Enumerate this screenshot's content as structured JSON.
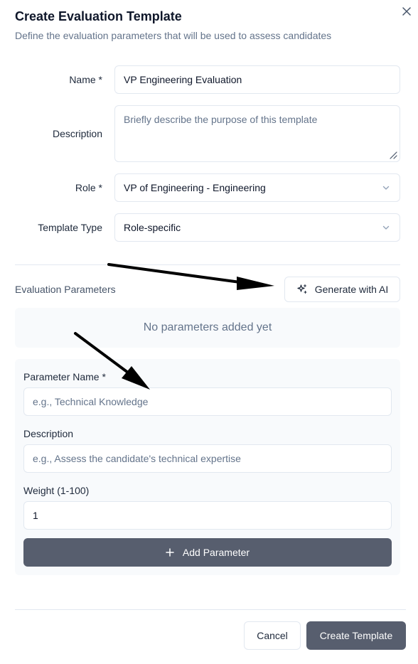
{
  "dialog": {
    "title": "Create Evaluation Template",
    "subtitle": "Define the evaluation parameters that will be used to assess candidates",
    "close_icon": "close-icon"
  },
  "form": {
    "name_label": "Name *",
    "name_value": "VP Engineering Evaluation",
    "description_label": "Description",
    "description_placeholder": "Briefly describe the purpose of this template",
    "role_label": "Role *",
    "role_value": "VP of Engineering - Engineering",
    "template_type_label": "Template Type",
    "template_type_value": "Role-specific"
  },
  "parameters": {
    "section_title": "Evaluation Parameters",
    "generate_label": "Generate with AI",
    "generate_icon": "sparkles-icon",
    "empty_text": "No parameters added yet",
    "param_name_label": "Parameter Name *",
    "param_name_placeholder": "e.g., Technical Knowledge",
    "param_desc_label": "Description",
    "param_desc_placeholder": "e.g., Assess the candidate's technical expertise",
    "weight_label": "Weight (1-100)",
    "weight_value": "1",
    "add_label": "Add Parameter",
    "add_icon": "plus-icon"
  },
  "footer": {
    "cancel_label": "Cancel",
    "create_label": "Create Template"
  },
  "colors": {
    "primary_button": "#575e6e",
    "border": "#e2e8f0",
    "muted_text": "#64748b",
    "panel_bg": "#f8fafc"
  }
}
